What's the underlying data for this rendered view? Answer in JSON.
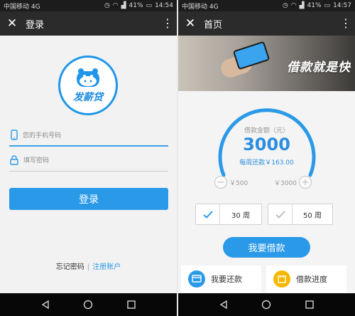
{
  "colors": {
    "accent": "#2a9ae8",
    "titlebar": "#2b2b2b",
    "statusbar": "#1c1c1c",
    "yellow": "#f5b800"
  },
  "login_screen": {
    "status": {
      "carrier": "中国移动 4G",
      "signal_icon": "signal-icon",
      "battery": "41%",
      "time": "14:54"
    },
    "title": "登录",
    "logo_text": "发薪贷",
    "phone_placeholder": "您的手机号码",
    "password_placeholder": "填写密码",
    "login_label": "登录",
    "forgot_label": "忘记密码",
    "separator": "|",
    "register_label": "注册账户"
  },
  "home_screen": {
    "status": {
      "carrier": "中国移动 4G",
      "battery": "41%",
      "time": "14:57"
    },
    "title": "首页",
    "banner_slogan": "借款就是快",
    "amount_label": "借款金额（元）",
    "amount": "3000",
    "weekly_repay": "每周还款￥163.00",
    "min_label": "￥500",
    "max_label": "￥3000",
    "minus": "−",
    "plus": "+",
    "options": [
      {
        "label": "30 周",
        "checked": true
      },
      {
        "label": "50 周",
        "checked": false
      }
    ],
    "borrow_label": "我要借款",
    "tiles": [
      {
        "label": "我要还款",
        "icon": "repay-icon"
      },
      {
        "label": "借款进度",
        "icon": "progress-icon"
      }
    ]
  }
}
